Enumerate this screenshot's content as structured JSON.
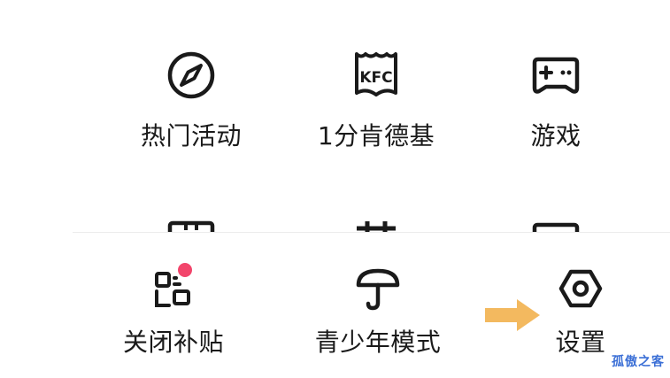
{
  "top_menu": {
    "items": [
      {
        "label": "热门活动",
        "icon": "compass-icon"
      },
      {
        "label": "1分肯德基",
        "icon": "kfc-icon"
      },
      {
        "label": "游戏",
        "icon": "gamepad-icon"
      }
    ]
  },
  "bottom_sheet": {
    "items": [
      {
        "label": "关闭补贴",
        "icon": "qr-code-icon",
        "badge_color": "#f2456b"
      },
      {
        "label": "青少年模式",
        "icon": "umbrella-icon"
      },
      {
        "label": "设置",
        "icon": "gear-icon"
      }
    ]
  },
  "annotation": {
    "arrow_color": "#f3b95f",
    "watermark": "孤傲之客"
  },
  "kfc_text": "KFC"
}
